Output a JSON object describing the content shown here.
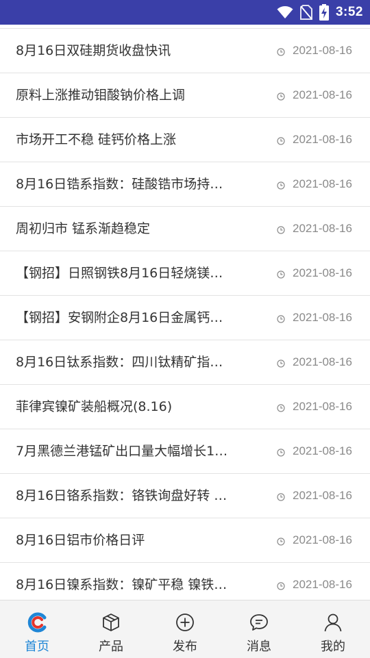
{
  "status_bar": {
    "time": "3:52"
  },
  "news": [
    {
      "title": "8月16日双硅期货收盘快讯",
      "date": "2021-08-16"
    },
    {
      "title": "原料上涨推动钼酸钠价格上调",
      "date": "2021-08-16"
    },
    {
      "title": "市场开工不稳 硅钙价格上涨",
      "date": "2021-08-16"
    },
    {
      "title": "8月16日锆系指数：硅酸锆市场持…",
      "date": "2021-08-16"
    },
    {
      "title": "周初归市 锰系渐趋稳定",
      "date": "2021-08-16"
    },
    {
      "title": "【钢招】日照钢铁8月16日轻烧镁…",
      "date": "2021-08-16"
    },
    {
      "title": "【钢招】安钢附企8月16日金属钙…",
      "date": "2021-08-16"
    },
    {
      "title": "8月16日钛系指数：四川钛精矿指…",
      "date": "2021-08-16"
    },
    {
      "title": "菲律宾镍矿装船概况(8.16)",
      "date": "2021-08-16"
    },
    {
      "title": "7月黑德兰港锰矿出口量大幅增长1…",
      "date": "2021-08-16"
    },
    {
      "title": "8月16日铬系指数：铬铁询盘好转 …",
      "date": "2021-08-16"
    },
    {
      "title": "8月16日铝市价格日评",
      "date": "2021-08-16"
    },
    {
      "title": "8月16日镍系指数：镍矿平稳 镍铁…",
      "date": "2021-08-16"
    }
  ],
  "tabs": [
    {
      "label": "首页",
      "icon": "home-logo-icon",
      "active": true
    },
    {
      "label": "产品",
      "icon": "box-icon"
    },
    {
      "label": "发布",
      "icon": "plus-circle-icon"
    },
    {
      "label": "消息",
      "icon": "chat-bubble-icon"
    },
    {
      "label": "我的",
      "icon": "person-icon"
    }
  ],
  "colors": {
    "status_bar": "#3a3fa8",
    "accent": "#1f86d6",
    "logo_red": "#e4342b"
  }
}
